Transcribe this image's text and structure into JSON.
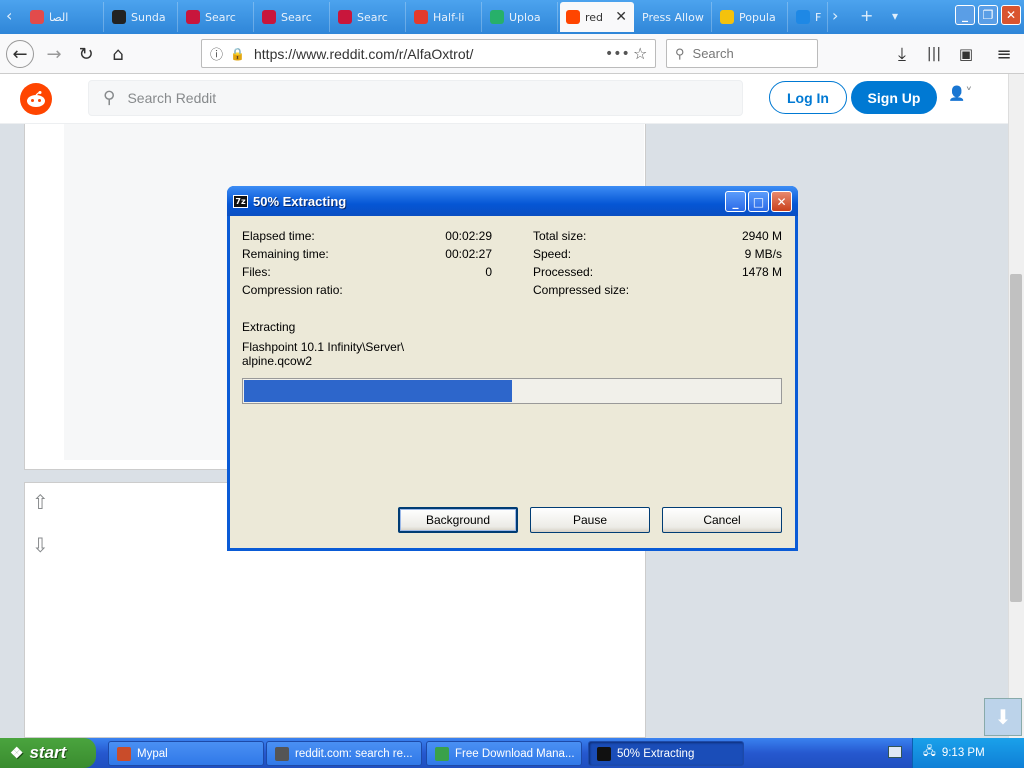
{
  "browser": {
    "tabs": [
      {
        "label": "الصا",
        "icon": "rainbow-icon",
        "color": "#e24b4b"
      },
      {
        "label": "Sunda",
        "icon": "pulse-icon",
        "color": "#222222"
      },
      {
        "label": "Searc",
        "icon": "search-favicon-icon",
        "color": "#c8163c"
      },
      {
        "label": "Searc",
        "icon": "search-favicon-icon",
        "color": "#c8163c"
      },
      {
        "label": "Searc",
        "icon": "search-favicon-icon",
        "color": "#c8163c"
      },
      {
        "label": "Half-li",
        "icon": "half-life-icon",
        "color": "#e33a2d"
      },
      {
        "label": "Uploa",
        "icon": "upload-icon",
        "color": "#27b06a"
      },
      {
        "label": "red",
        "icon": "reddit-icon",
        "color": "#ff4500",
        "active": true
      },
      {
        "label": "Press Allow",
        "icon": "",
        "color": ""
      },
      {
        "label": "Popula",
        "icon": "smiley-icon",
        "color": "#f4c20d"
      },
      {
        "label": "F",
        "icon": "app-icon",
        "color": "#1e88e5"
      }
    ],
    "url": "https://www.reddit.com/r/AlfaOxtrot/",
    "search_placeholder": "Search"
  },
  "reddit": {
    "search_placeholder": "Search Reddit",
    "login_label": "Log In",
    "signup_label": "Sign Up",
    "brand_color": "#ff4500",
    "accent_color": "#0079d3"
  },
  "dialog": {
    "title": "50% Extracting",
    "icon_text": "7z",
    "left_stats": [
      {
        "label": "Elapsed time:",
        "value": "00:02:29"
      },
      {
        "label": "Remaining time:",
        "value": "00:02:27"
      },
      {
        "label": "Files:",
        "value": "0"
      },
      {
        "label": "Compression ratio:",
        "value": ""
      }
    ],
    "right_stats": [
      {
        "label": "Total size:",
        "value": "2940 M"
      },
      {
        "label": "Speed:",
        "value": "9 MB/s"
      },
      {
        "label": "Processed:",
        "value": "1478 M"
      },
      {
        "label": "Compressed size:",
        "value": ""
      }
    ],
    "status_label": "Extracting",
    "path_line1": "Flashpoint 10.1 Infinity\\Server\\",
    "path_line2": "alpine.qcow2",
    "progress_fraction": 0.5,
    "buttons": {
      "background": "Background",
      "pause": "Pause",
      "cancel": "Cancel"
    }
  },
  "taskbar": {
    "start_label": "start",
    "tasks": [
      {
        "label": "Mypal",
        "icon": "mypal-icon"
      },
      {
        "label": "reddit.com: search re...",
        "icon": "browser-icon"
      },
      {
        "label": "Free Download Mana...",
        "icon": "fdm-icon"
      },
      {
        "label": "50% Extracting",
        "icon": "7zip-icon",
        "active": true
      }
    ],
    "clock": "9:13 PM"
  }
}
